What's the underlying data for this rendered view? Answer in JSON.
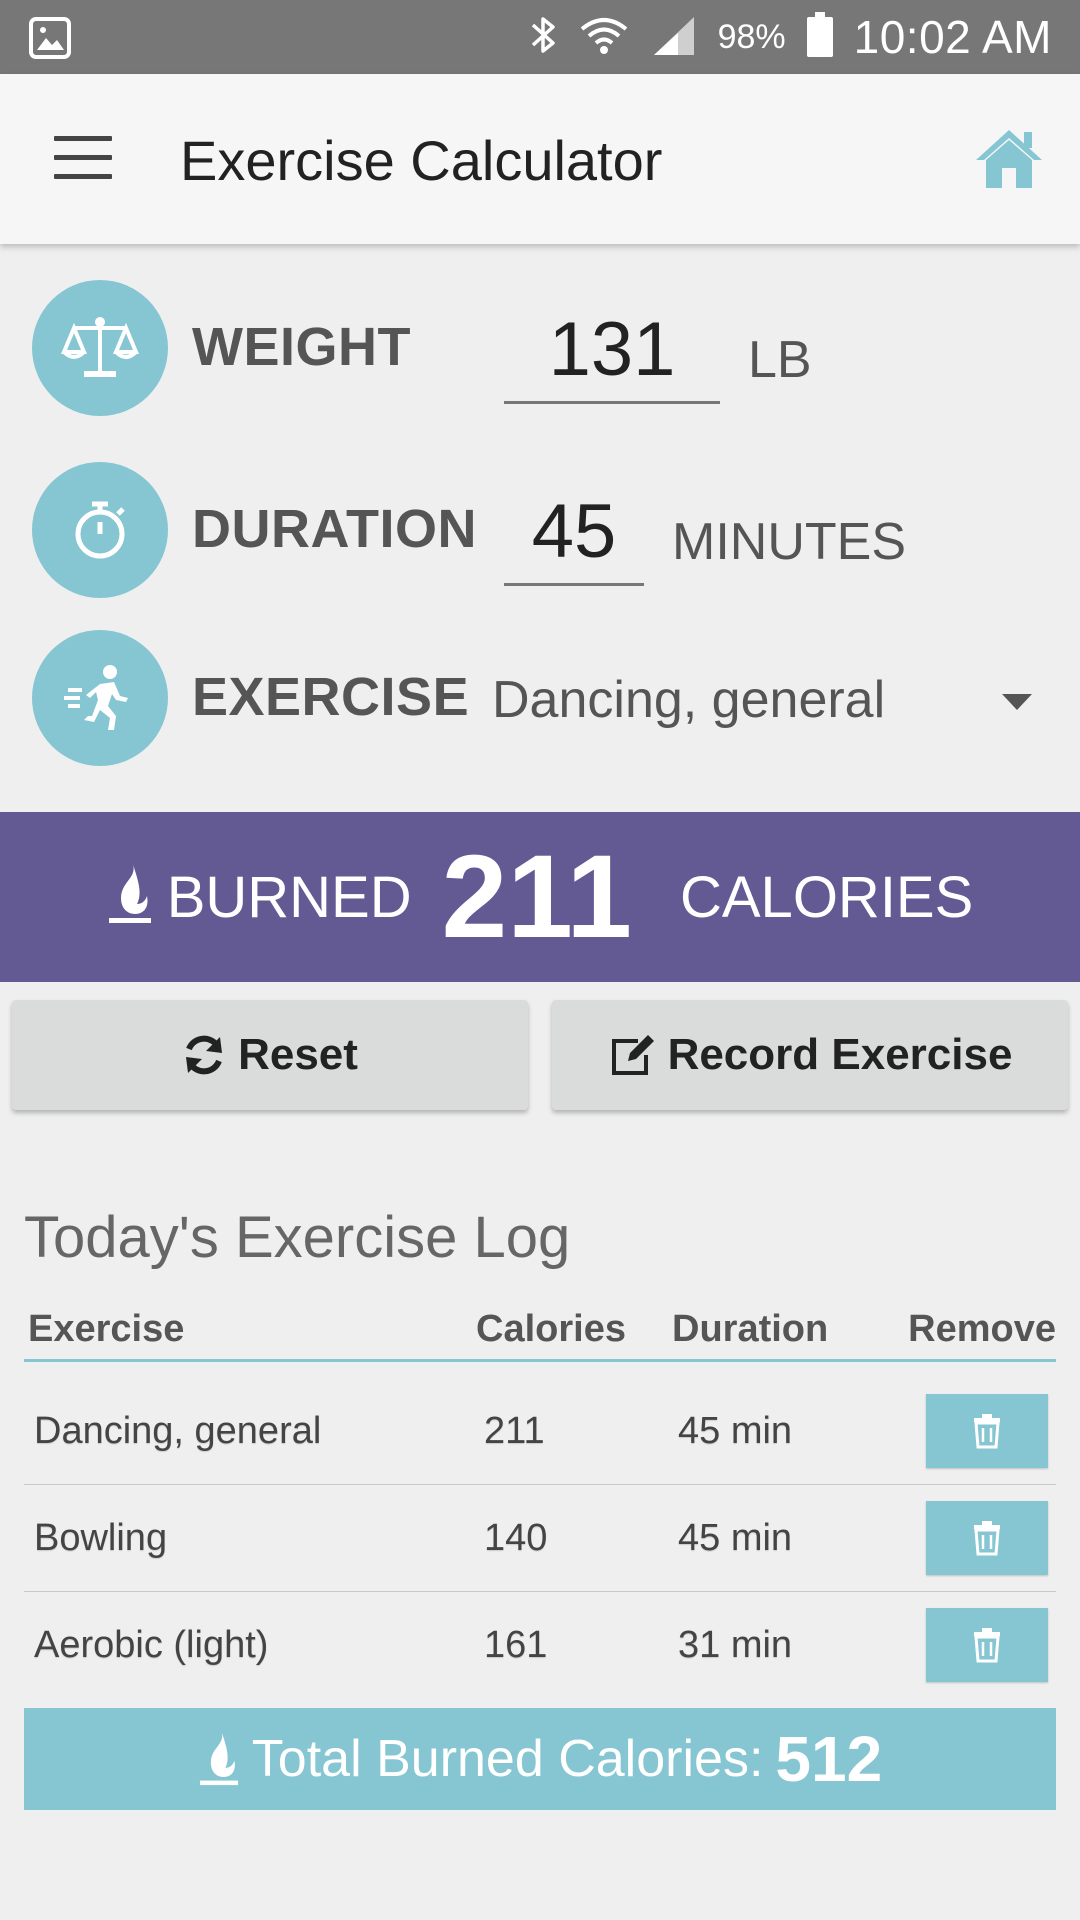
{
  "status_bar": {
    "battery_pct": "98%",
    "time": "10:02 AM"
  },
  "app_bar": {
    "title": "Exercise Calculator"
  },
  "inputs": {
    "weight": {
      "label": "WEIGHT",
      "value": "131",
      "unit": "LB"
    },
    "duration": {
      "label": "DURATION",
      "value": "45",
      "unit": "MINUTES"
    },
    "exercise": {
      "label": "EXERCISE",
      "selected": "Dancing, general"
    }
  },
  "burned": {
    "prefix": "BURNED",
    "value": "211",
    "unit": "CALORIES"
  },
  "buttons": {
    "reset": "Reset",
    "record": "Record Exercise"
  },
  "log": {
    "title": "Today's Exercise Log",
    "headers": {
      "exercise": "Exercise",
      "calories": "Calories",
      "duration": "Duration",
      "remove": "Remove"
    },
    "rows": [
      {
        "exercise": "Dancing, general",
        "calories": "211",
        "duration": "45 min"
      },
      {
        "exercise": "Bowling",
        "calories": "140",
        "duration": "45 min"
      },
      {
        "exercise": "Aerobic (light)",
        "calories": "161",
        "duration": "31 min"
      }
    ]
  },
  "total": {
    "label": "Total Burned Calories:",
    "value": "512"
  },
  "colors": {
    "accent": "#85c6d2",
    "banner": "#635a94",
    "status_bar": "#777777"
  }
}
